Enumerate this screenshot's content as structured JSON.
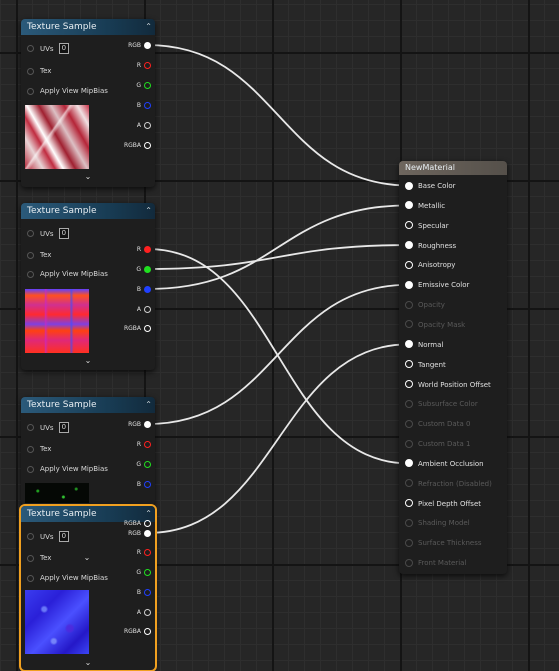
{
  "colors": {
    "pin_rgb": "#ffffff",
    "pin_r": "#ff2020",
    "pin_g": "#20e020",
    "pin_b": "#2040ff",
    "pin_a": "#d0d0d0",
    "pin_rgba": "#ffffff",
    "selected_outline": "#f0a020",
    "wire": "#e8e8e8"
  },
  "texture_nodes": [
    {
      "title": "Texture Sample",
      "uvs_label": "UVs",
      "uvs_value": "0",
      "tex_label": "Tex",
      "mip_label": "Apply View MipBias",
      "outputs": [
        "RGB",
        "R",
        "G",
        "B",
        "A",
        "RGBA"
      ],
      "expand_icon": "chevron-down-icon"
    },
    {
      "title": "Texture Sample",
      "uvs_label": "UVs",
      "uvs_value": "0",
      "tex_label": "Tex",
      "mip_label": "Apply View MipBias",
      "outputs": [
        "R",
        "G",
        "B",
        "A",
        "RGBA"
      ],
      "expand_icon": "chevron-down-icon"
    },
    {
      "title": "Texture Sample",
      "uvs_label": "UVs",
      "uvs_value": "0",
      "tex_label": "Tex",
      "mip_label": "Apply View MipBias",
      "outputs": [
        "RGB",
        "R",
        "G",
        "B"
      ],
      "expand_icon": "chevron-down-icon"
    },
    {
      "title": "Texture Sample",
      "selected": true,
      "uvs_label": "UVs",
      "uvs_value": "0",
      "tex_label": "Tex",
      "mip_label": "Apply View MipBias",
      "outputs": [
        "RGBA",
        "RGB",
        "R",
        "G",
        "B",
        "A",
        "RGBA"
      ],
      "expand_icon": "chevron-down-icon"
    }
  ],
  "material_node": {
    "title": "NewMaterial",
    "inputs": [
      {
        "label": "Base Color",
        "state": "connected"
      },
      {
        "label": "Metallic",
        "state": "connected"
      },
      {
        "label": "Specular",
        "state": "enabled"
      },
      {
        "label": "Roughness",
        "state": "connected"
      },
      {
        "label": "Anisotropy",
        "state": "enabled"
      },
      {
        "label": "Emissive Color",
        "state": "connected"
      },
      {
        "label": "Opacity",
        "state": "disabled"
      },
      {
        "label": "Opacity Mask",
        "state": "disabled"
      },
      {
        "label": "Normal",
        "state": "connected"
      },
      {
        "label": "Tangent",
        "state": "enabled"
      },
      {
        "label": "World Position Offset",
        "state": "enabled"
      },
      {
        "label": "Subsurface Color",
        "state": "disabled"
      },
      {
        "label": "Custom Data 0",
        "state": "disabled"
      },
      {
        "label": "Custom Data 1",
        "state": "disabled"
      },
      {
        "label": "Ambient Occlusion",
        "state": "connected"
      },
      {
        "label": "Refraction (Disabled)",
        "state": "disabled"
      },
      {
        "label": "Pixel Depth Offset",
        "state": "enabled"
      },
      {
        "label": "Shading Model",
        "state": "disabled"
      },
      {
        "label": "Surface Thickness",
        "state": "disabled"
      },
      {
        "label": "Front Material",
        "state": "disabled"
      }
    ]
  },
  "connections": [
    {
      "from_node": 0,
      "from_output": "RGB",
      "to_input": "Base Color"
    },
    {
      "from_node": 1,
      "from_output": "R",
      "to_input": "Ambient Occlusion"
    },
    {
      "from_node": 1,
      "from_output": "G",
      "to_input": "Roughness"
    },
    {
      "from_node": 1,
      "from_output": "B",
      "to_input": "Metallic"
    },
    {
      "from_node": 2,
      "from_output": "RGB",
      "to_input": "Emissive Color"
    },
    {
      "from_node": 3,
      "from_output": "RGB",
      "to_input": "Normal"
    }
  ]
}
